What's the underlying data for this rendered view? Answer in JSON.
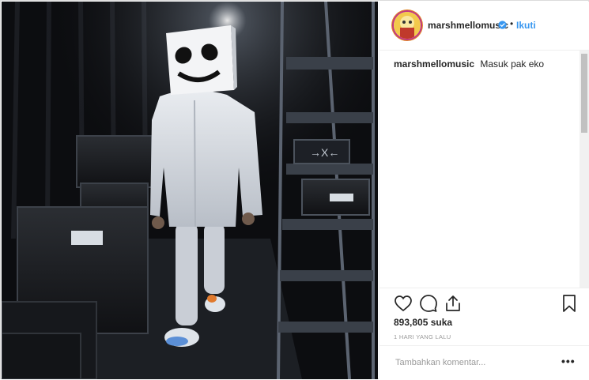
{
  "post": {
    "username": "marshmellomusic",
    "separator": "•",
    "follow_label": "Ikuti",
    "caption": {
      "username": "marshmellomusic",
      "text": "Masuk pak eko"
    },
    "likes": "893,805 suka",
    "time": "1 HARI YANG LALU",
    "comment_placeholder": "Tambahkan komentar...",
    "more_label": "•••"
  },
  "icons": {
    "verified": "verified-badge-icon",
    "like": "heart-icon",
    "comment": "comment-bubble-icon",
    "share": "share-icon",
    "save": "bookmark-icon"
  },
  "colors": {
    "link": "#3897f0",
    "verified": "#3897f0",
    "text": "#262626",
    "muted": "#999999",
    "border": "#efefef"
  }
}
